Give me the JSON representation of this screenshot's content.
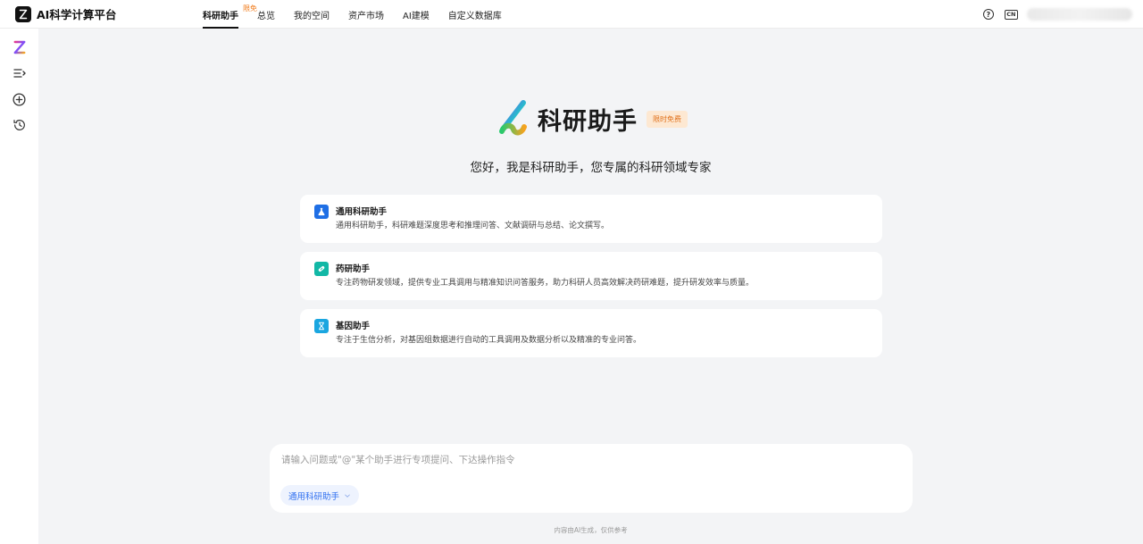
{
  "topbar": {
    "brand_name": "AI科学计算平台",
    "nav": [
      {
        "label": "科研助手",
        "badge": "限免",
        "active": true
      },
      {
        "label": "总览"
      },
      {
        "label": "我的空间"
      },
      {
        "label": "资产市场"
      },
      {
        "label": "AI建模"
      },
      {
        "label": "自定义数据库"
      }
    ],
    "lang_label": "CN"
  },
  "sidebar": {
    "icons": [
      "logo-icon",
      "list-icon",
      "new-chat-icon",
      "history-icon"
    ]
  },
  "hero": {
    "title": "科研助手",
    "badge": "限时免费",
    "subtitle": "您好，我是科研助手，您专属的科研领域专家"
  },
  "cards": [
    {
      "title": "通用科研助手",
      "desc": "通用科研助手，科研难题深度思考和推理问答、文献调研与总结、论文撰写。",
      "icon": "flask-icon",
      "color": "#1f6fe5"
    },
    {
      "title": "药研助手",
      "desc": "专注药物研发领域，提供专业工具调用与精准知识问答服务，助力科研人员高效解决药研难题，提升研发效率与质量。",
      "icon": "pill-icon",
      "color": "#12b8a6"
    },
    {
      "title": "基因助手",
      "desc": "专注于生信分析，对基因组数据进行自动的工具调用及数据分析以及精准的专业问答。",
      "icon": "dna-icon",
      "color": "#1aa6e0"
    }
  ],
  "input": {
    "placeholder": "请输入问题或\"@\"某个助手进行专项提问、下达操作指令",
    "assistant_select": "通用科研助手"
  },
  "footer": "内容由AI生成，仅供参考"
}
